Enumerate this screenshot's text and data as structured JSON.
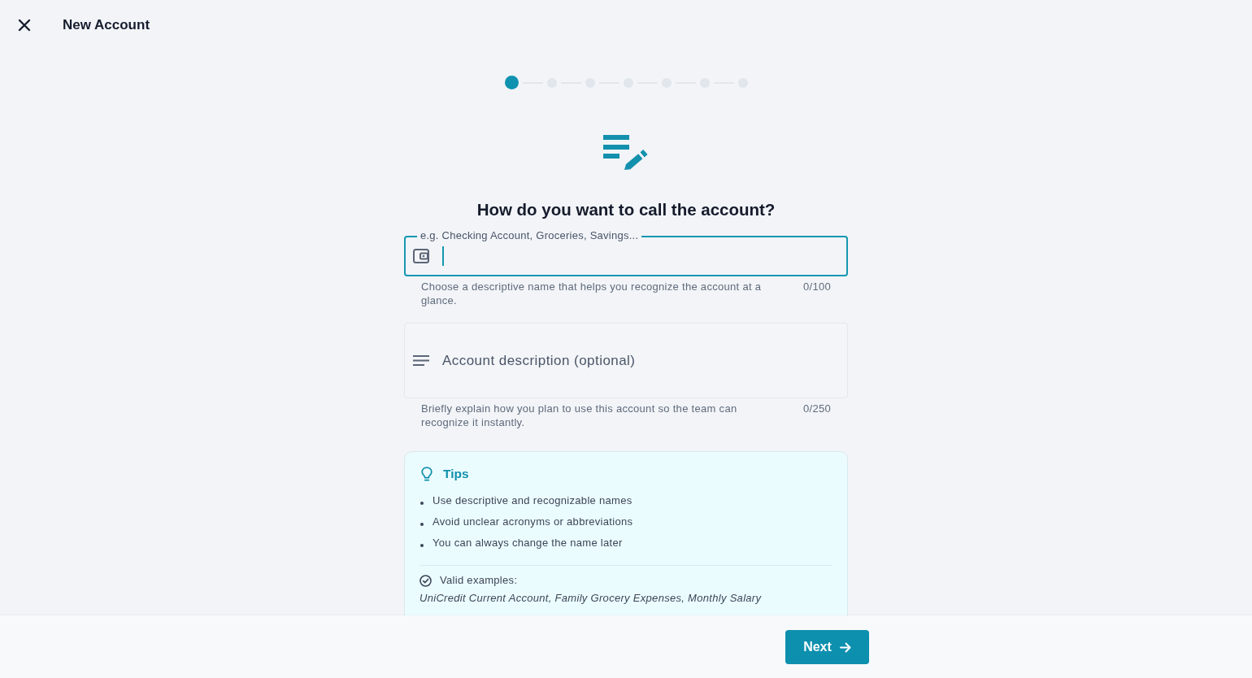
{
  "header": {
    "title": "New Account"
  },
  "steps": [
    {
      "selected": true
    },
    {
      "selected": false
    },
    {
      "selected": false
    },
    {
      "selected": false
    },
    {
      "selected": false
    },
    {
      "selected": false
    },
    {
      "selected": false
    }
  ],
  "heading": "How do you want to call the account?",
  "name_field": {
    "label": "e.g. Checking Account, Groceries, Savings...",
    "focused": true,
    "helper": "Choose a descriptive name that helps you recognize the account at a glance.",
    "counter": "0/100"
  },
  "description_field": {
    "placeholder": "Account description (optional)",
    "focused": false,
    "helper": "Briefly explain how you plan to use this account so the team can recognize it instantly.",
    "counter": "0/250"
  },
  "tips": {
    "title": "Tips",
    "items": [
      "Use descriptive and recognizable names",
      "Avoid unclear acronyms or abbreviations",
      "You can always change the name later"
    ],
    "examples_label": "Valid examples:",
    "examples": "UniCredit Current Account, Family Grocery Expenses, Monthly Salary"
  },
  "footer": {
    "next_button": "Next"
  }
}
